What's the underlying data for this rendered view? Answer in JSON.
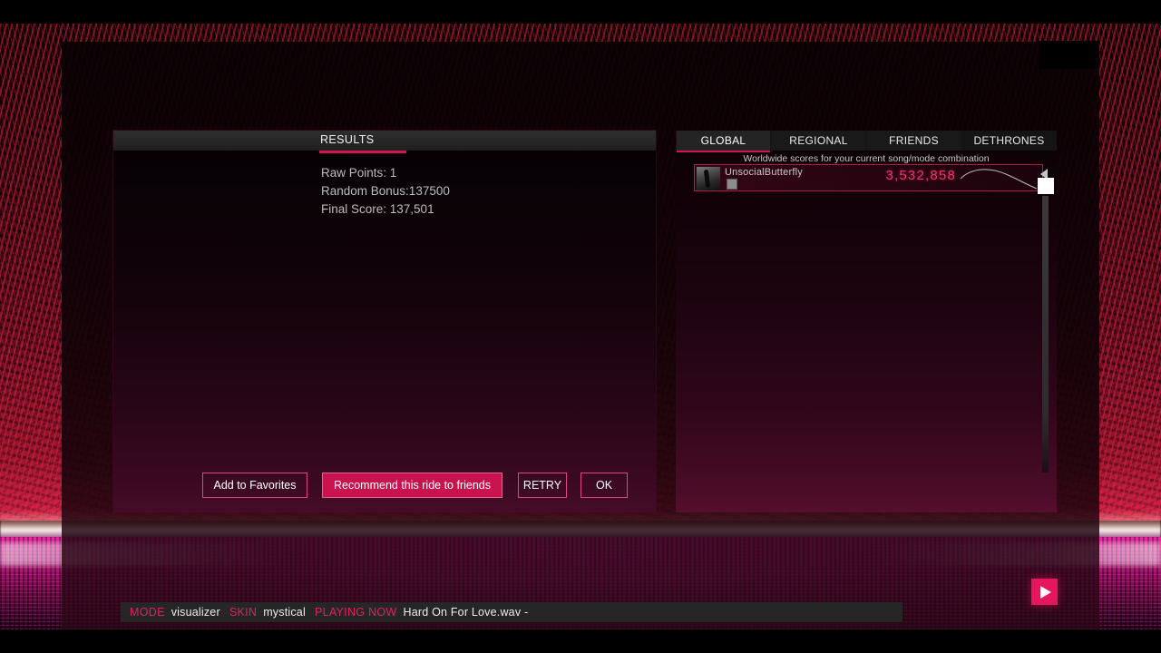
{
  "results": {
    "header_title": "RESULTS",
    "lines": [
      "Raw Points: 1",
      "Random Bonus:137500",
      "Final Score: 137,501"
    ],
    "buttons": {
      "add_to_favorites": "Add to Favorites",
      "recommend": "Recommend this ride to friends",
      "retry": "RETRY",
      "ok": "OK"
    }
  },
  "leaderboard": {
    "tabs": [
      {
        "label": "GLOBAL",
        "active": true
      },
      {
        "label": "REGIONAL",
        "active": false
      },
      {
        "label": "FRIENDS",
        "active": false
      },
      {
        "label": "DETHRONES",
        "active": false
      }
    ],
    "subtitle": "Worldwide scores for your current song/mode combination",
    "entries": [
      {
        "name": "UnsocialButterfly",
        "score": "3,532,858"
      }
    ]
  },
  "status_bar": {
    "mode_key": "MODE",
    "mode_value": "visualizer",
    "skin_key": "SKIN",
    "skin_value": "mystical",
    "playing_key": "PLAYING NOW",
    "playing_value": "Hard On For Love.wav -"
  },
  "colors": {
    "accent_pink": "#d41551",
    "accent_bright": "#e5165e",
    "score_pink": "#e6376d",
    "panel_text": "#bdbdbd"
  }
}
